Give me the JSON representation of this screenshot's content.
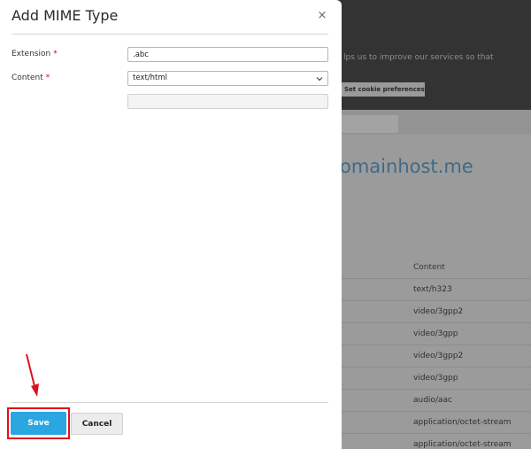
{
  "background": {
    "cookie_text": "lps us to improve our services so that",
    "cookie_button": "Set cookie preferences",
    "host_title": "omainhost.me",
    "column_header": "Content",
    "rows": [
      "text/h323",
      "video/3gpp2",
      "video/3gpp",
      "video/3gpp2",
      "video/3gpp",
      "audio/aac",
      "application/octet-stream",
      "application/octet-stream"
    ]
  },
  "modal": {
    "title": "Add MIME Type",
    "close_glyph": "×",
    "extension_label": "Extension",
    "required_mark": "*",
    "extension_value": ".abc",
    "content_label": "Content",
    "content_value": "text/html",
    "save_label": "Save",
    "cancel_label": "Cancel"
  },
  "colors": {
    "primary_button": "#2aa6e0",
    "required": "#d0021b",
    "highlight": "#e0101f",
    "link_title": "#3f6a86"
  },
  "icons": {
    "close": "close-icon",
    "dropdown": "chevron-down-icon",
    "annotation": "arrow-icon"
  }
}
